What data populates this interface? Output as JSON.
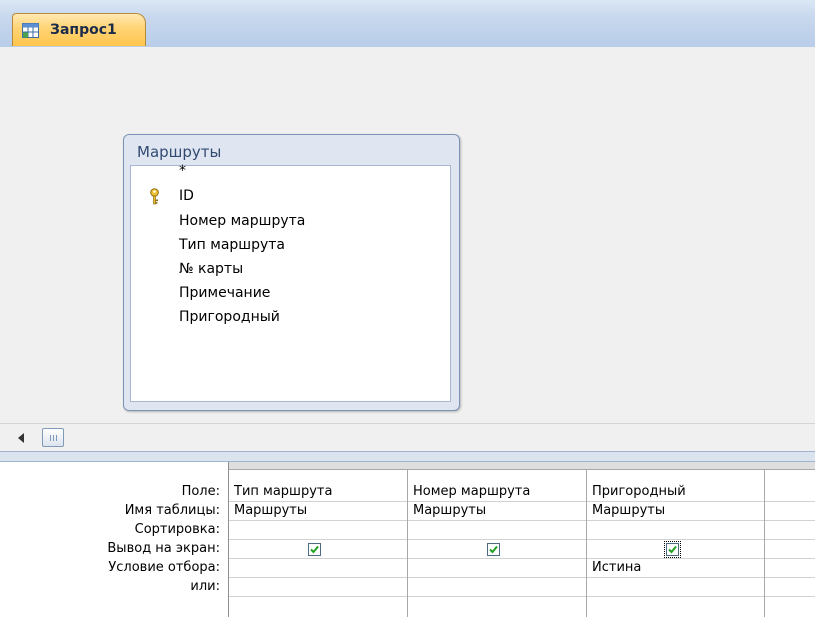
{
  "tab": {
    "title": "Запрос1"
  },
  "table": {
    "title": "Маршруты",
    "fields": [
      "*",
      "ID",
      "Номер маршрута",
      "Тип маршрута",
      "№ карты",
      "Примечание",
      "Пригородный"
    ]
  },
  "grid": {
    "row_labels": {
      "field": "Поле:",
      "table": "Имя таблицы:",
      "sort": "Сортировка:",
      "show": "Вывод на экран:",
      "criteria": "Условие отбора:",
      "or": "или:"
    },
    "columns": [
      {
        "field": "Тип маршрута",
        "table": "Маршруты",
        "sort": "",
        "show": true,
        "criteria": ""
      },
      {
        "field": "Номер маршрута",
        "table": "Маршруты",
        "sort": "",
        "show": true,
        "criteria": ""
      },
      {
        "field": "Пригородный",
        "table": "Маршруты",
        "sort": "",
        "show": true,
        "criteria": "Истина"
      }
    ]
  }
}
